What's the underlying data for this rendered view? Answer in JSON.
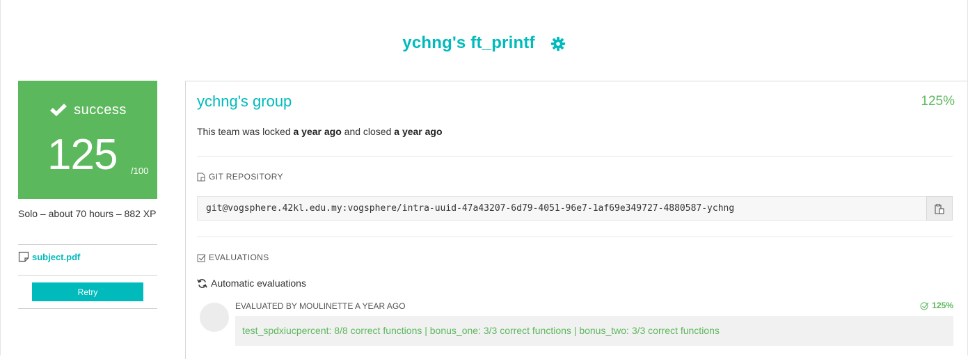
{
  "project": {
    "title": "ychng's ft_printf"
  },
  "score_card": {
    "status": "success",
    "score": "125",
    "max": "/100",
    "color": "#5cb85c"
  },
  "meta": {
    "description": "Solo – about 70 hours – 882 XP"
  },
  "subject": {
    "file_label": "subject.pdf"
  },
  "actions": {
    "retry_label": "Retry"
  },
  "team": {
    "name": "ychng's group",
    "percent": "125%",
    "lock_prefix": "This team was locked ",
    "locked_when": "a year ago",
    "lock_middle": " and closed ",
    "closed_when": "a year ago"
  },
  "git": {
    "section_label": "GIT REPOSITORY",
    "url": "git@vogsphere.42kl.edu.my:vogsphere/intra-uuid-47a43207-6d79-4051-96e7-1af69e349727-4880587-ychng"
  },
  "evaluations": {
    "section_label": "EVALUATIONS",
    "automatic_label": "Automatic evaluations",
    "evaluator": "EVALUATED BY MOULINETTE A YEAR AGO",
    "score": "125%",
    "result": "test_spdxiucpercent: 8/8 correct functions | bonus_one: 3/3 correct functions | bonus_two: 3/3 correct functions"
  },
  "colors": {
    "accent": "#00babc",
    "success": "#5cb85c"
  },
  "icons": [
    "gear-icon",
    "check-icon",
    "file-icon",
    "git-icon",
    "copy-icon",
    "checkbox-icon",
    "refresh-icon"
  ]
}
